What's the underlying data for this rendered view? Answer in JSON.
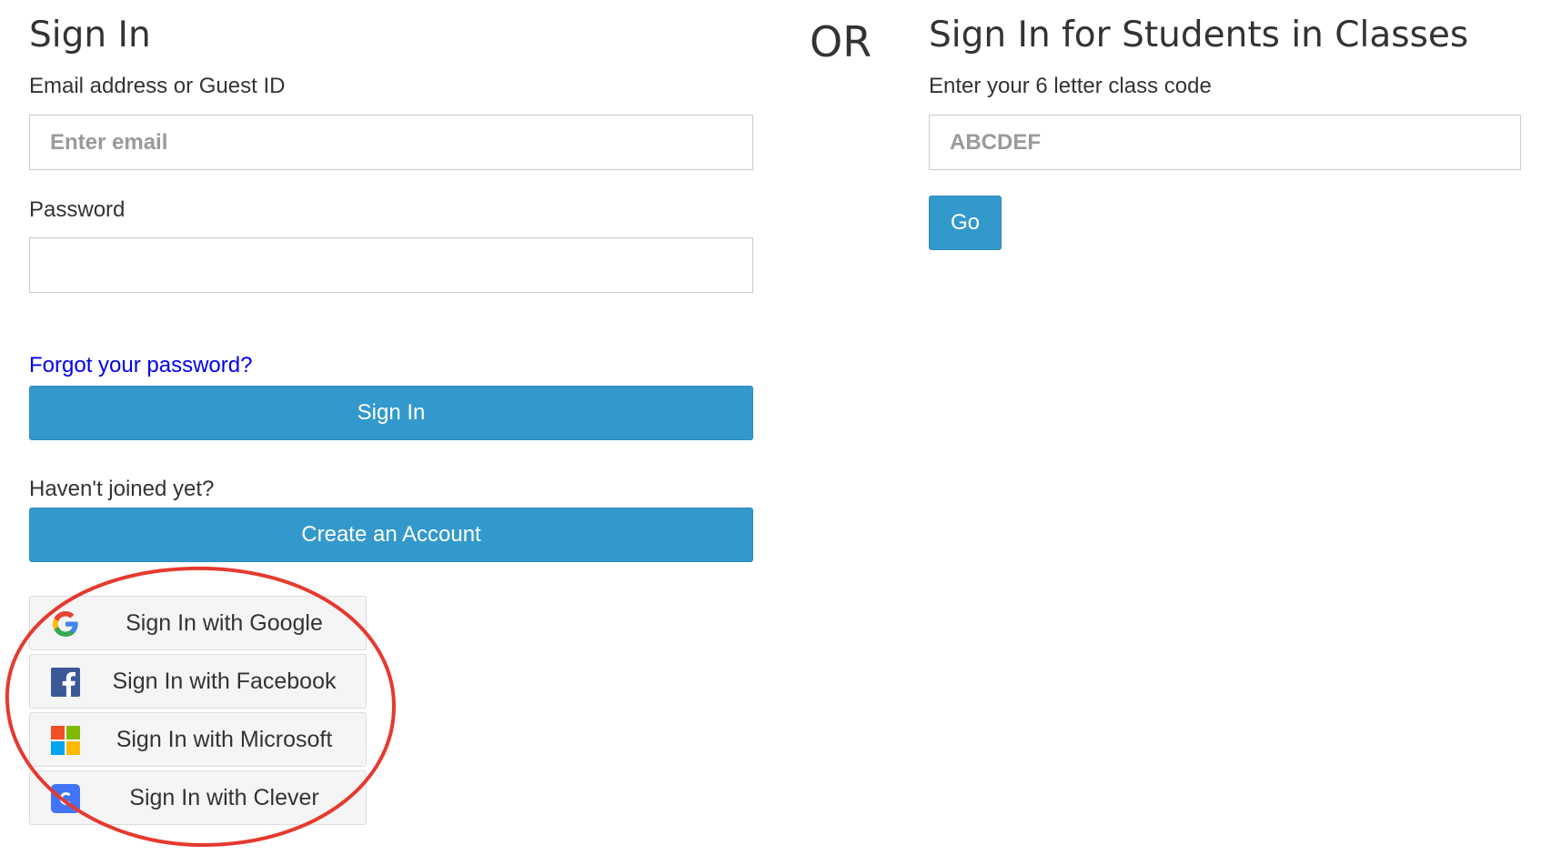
{
  "sign_in": {
    "title": "Sign In",
    "email_label": "Email address or Guest ID",
    "email_placeholder": "Enter email",
    "email_value": "",
    "password_label": "Password",
    "password_value": "",
    "forgot_link": "Forgot your password?",
    "submit_label": "Sign In",
    "join_prompt": "Haven't joined yet?",
    "create_account_label": "Create an Account"
  },
  "divider": {
    "text": "OR"
  },
  "class_sign_in": {
    "title": "Sign In for Students in Classes",
    "code_label": "Enter your 6 letter class code",
    "code_placeholder": "ABCDEF",
    "code_value": "",
    "go_label": "Go"
  },
  "social_logins": [
    {
      "label": "Sign In with Google",
      "icon": "google-icon"
    },
    {
      "label": "Sign In with Facebook",
      "icon": "facebook-icon"
    },
    {
      "label": "Sign In with Microsoft",
      "icon": "microsoft-icon"
    },
    {
      "label": "Sign In with Clever",
      "icon": "clever-icon"
    }
  ],
  "colors": {
    "primary_button": "#3399cc",
    "link": "#0000ee",
    "highlight_annotation": "#e53a2f",
    "social_button_bg": "#f5f5f5"
  }
}
